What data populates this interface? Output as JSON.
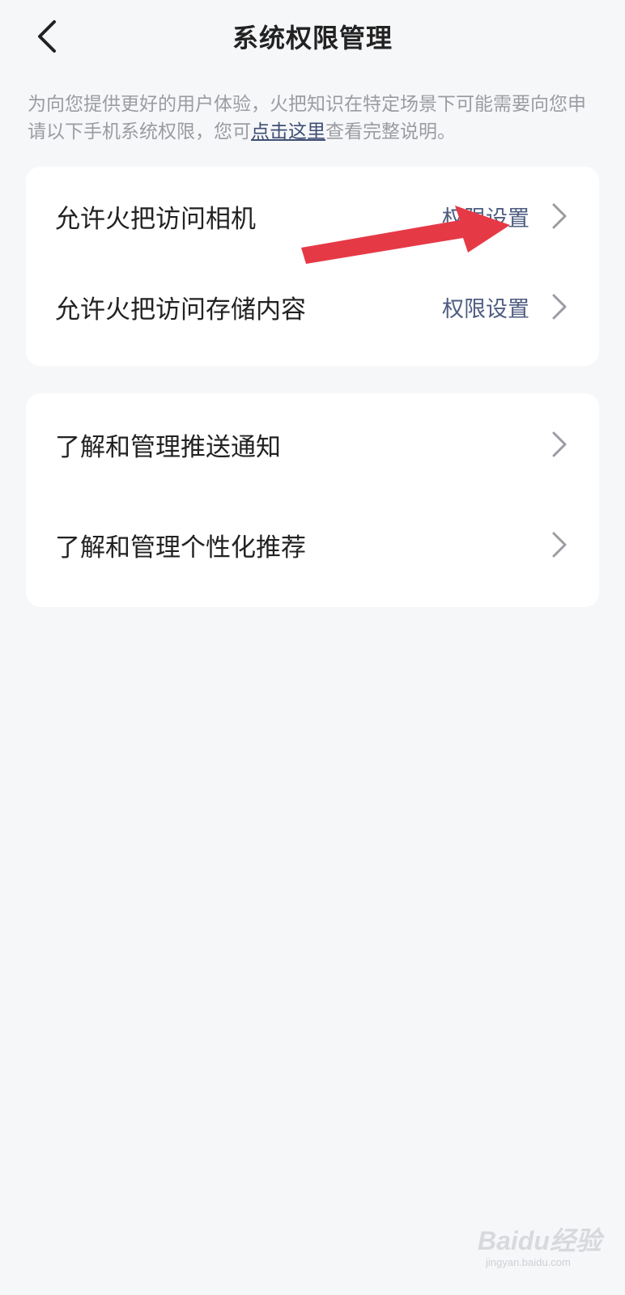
{
  "header": {
    "title": "系统权限管理",
    "back_icon": "chevron-left-icon"
  },
  "intro": {
    "text_before": "为向您提供更好的用户体验，火把知识在特定场景下可能需要向您申请以下手机系统权限，您可",
    "link_text": "点击这里",
    "text_after": "查看完整说明。"
  },
  "permissions": [
    {
      "label": "允许火把访问相机",
      "action": "权限设置"
    },
    {
      "label": "允许火把访问存储内容",
      "action": "权限设置"
    }
  ],
  "management": [
    {
      "label": "了解和管理推送通知"
    },
    {
      "label": "了解和管理个性化推荐"
    }
  ],
  "colors": {
    "background": "#f6f7f9",
    "card": "#ffffff",
    "title_text": "#222222",
    "secondary_text": "#9a9ca2",
    "action_text": "#4e5d80",
    "annotation_arrow": "#e63946"
  },
  "watermark": {
    "brand": "Baidu经验",
    "url": "jingyan.baidu.com"
  }
}
